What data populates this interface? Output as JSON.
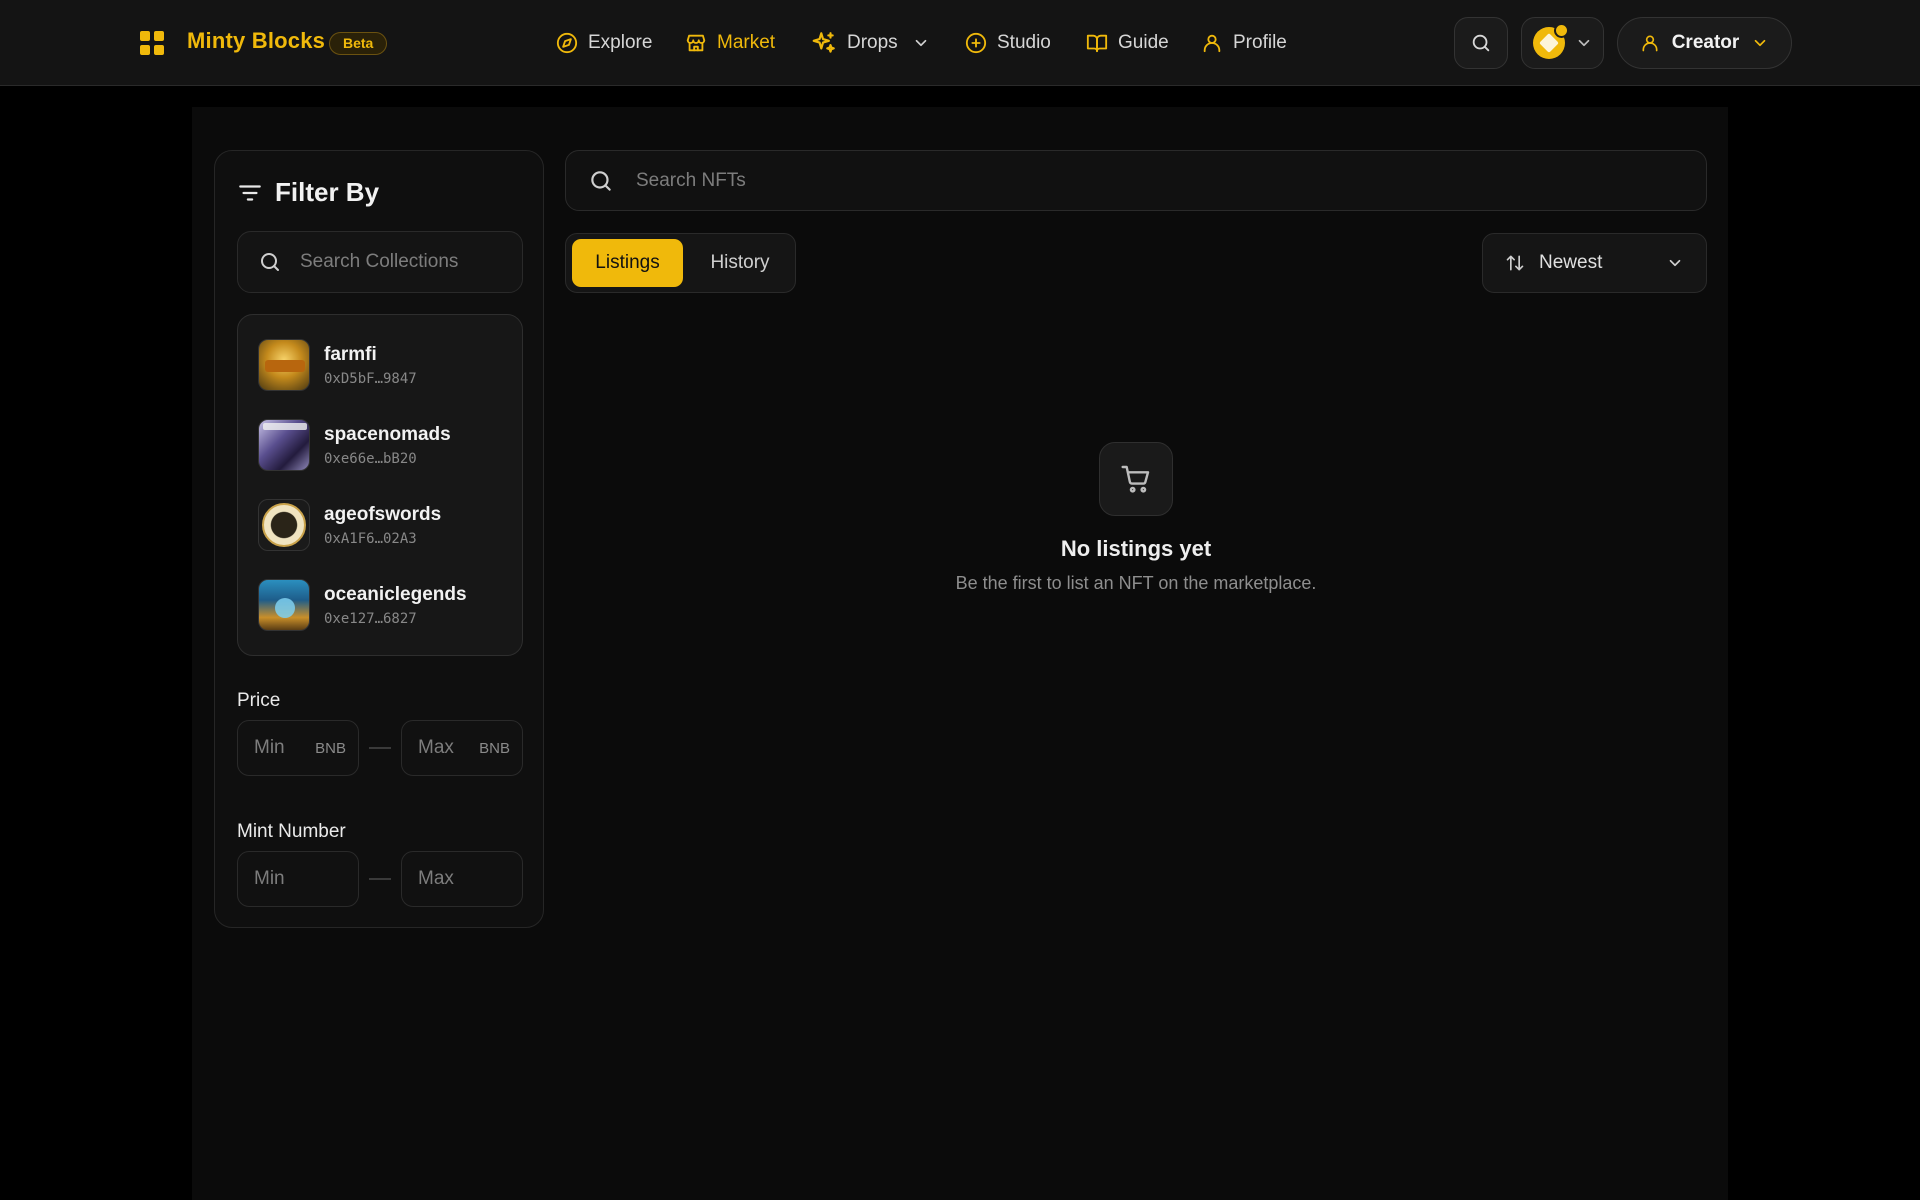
{
  "brand": {
    "name": "Minty Blocks",
    "badge": "Beta"
  },
  "nav": [
    {
      "label": "Explore",
      "icon": "compass-icon"
    },
    {
      "label": "Market",
      "icon": "store-icon",
      "active": true
    },
    {
      "label": "Drops",
      "icon": "sparkles-icon",
      "has_dropdown": true
    },
    {
      "label": "Studio",
      "icon": "plus-circle-icon"
    },
    {
      "label": "Guide",
      "icon": "book-icon"
    },
    {
      "label": "Profile",
      "icon": "user-icon"
    }
  ],
  "header_actions": {
    "role_label": "Creator",
    "chain_icon": "bnb-coin-icon"
  },
  "sidebar": {
    "title": "Filter By",
    "search_placeholder": "Search Collections",
    "collections": [
      {
        "name": "farmfi",
        "address": "0xD5bF…9847"
      },
      {
        "name": "spacenomads",
        "address": "0xe66e…bB20"
      },
      {
        "name": "ageofswords",
        "address": "0xA1F6…02A3"
      },
      {
        "name": "oceaniclegends",
        "address": "0xe127…6827"
      }
    ],
    "price": {
      "label": "Price",
      "min_placeholder": "Min",
      "max_placeholder": "Max",
      "unit": "BNB"
    },
    "mint_number": {
      "label": "Mint Number",
      "min_placeholder": "Min",
      "max_placeholder": "Max"
    }
  },
  "main": {
    "search_placeholder": "Search NFTs",
    "tabs": [
      {
        "label": "Listings",
        "active": true
      },
      {
        "label": "History"
      }
    ],
    "sort_label": "Newest",
    "empty": {
      "title": "No listings yet",
      "subtitle": "Be the first to list an NFT on the marketplace."
    }
  },
  "colors": {
    "accent": "#f0b90b",
    "background": "#000000",
    "panel": "#0b0b0b",
    "header": "#141414"
  }
}
